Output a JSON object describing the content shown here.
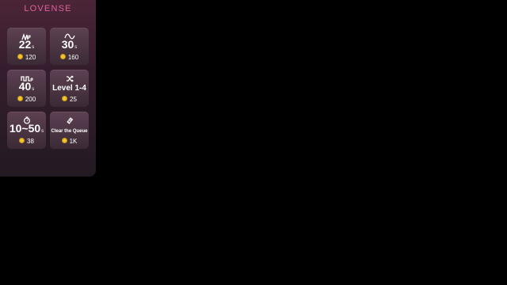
{
  "app": {
    "logo_text": "LOVENSE",
    "accent_color": "#e0609b",
    "coin_color": "#f2c230"
  },
  "tiles": [
    {
      "icon": "pulse-wave-icon",
      "value": "22",
      "unit": "s",
      "price": "120"
    },
    {
      "icon": "sine-wave-icon",
      "value": "30",
      "unit": "s",
      "price": "160"
    },
    {
      "icon": "square-wave-icon",
      "value": "40",
      "unit": "s",
      "price": "200"
    },
    {
      "icon": "shuffle-icon",
      "value": "Level 1-4",
      "unit": "",
      "price": "25"
    },
    {
      "icon": "timer-icon",
      "value": "10~50",
      "unit": "s",
      "price": "38"
    },
    {
      "icon": "eraser-icon",
      "value": "Clear the Queue",
      "unit": "",
      "price": "1K"
    }
  ]
}
